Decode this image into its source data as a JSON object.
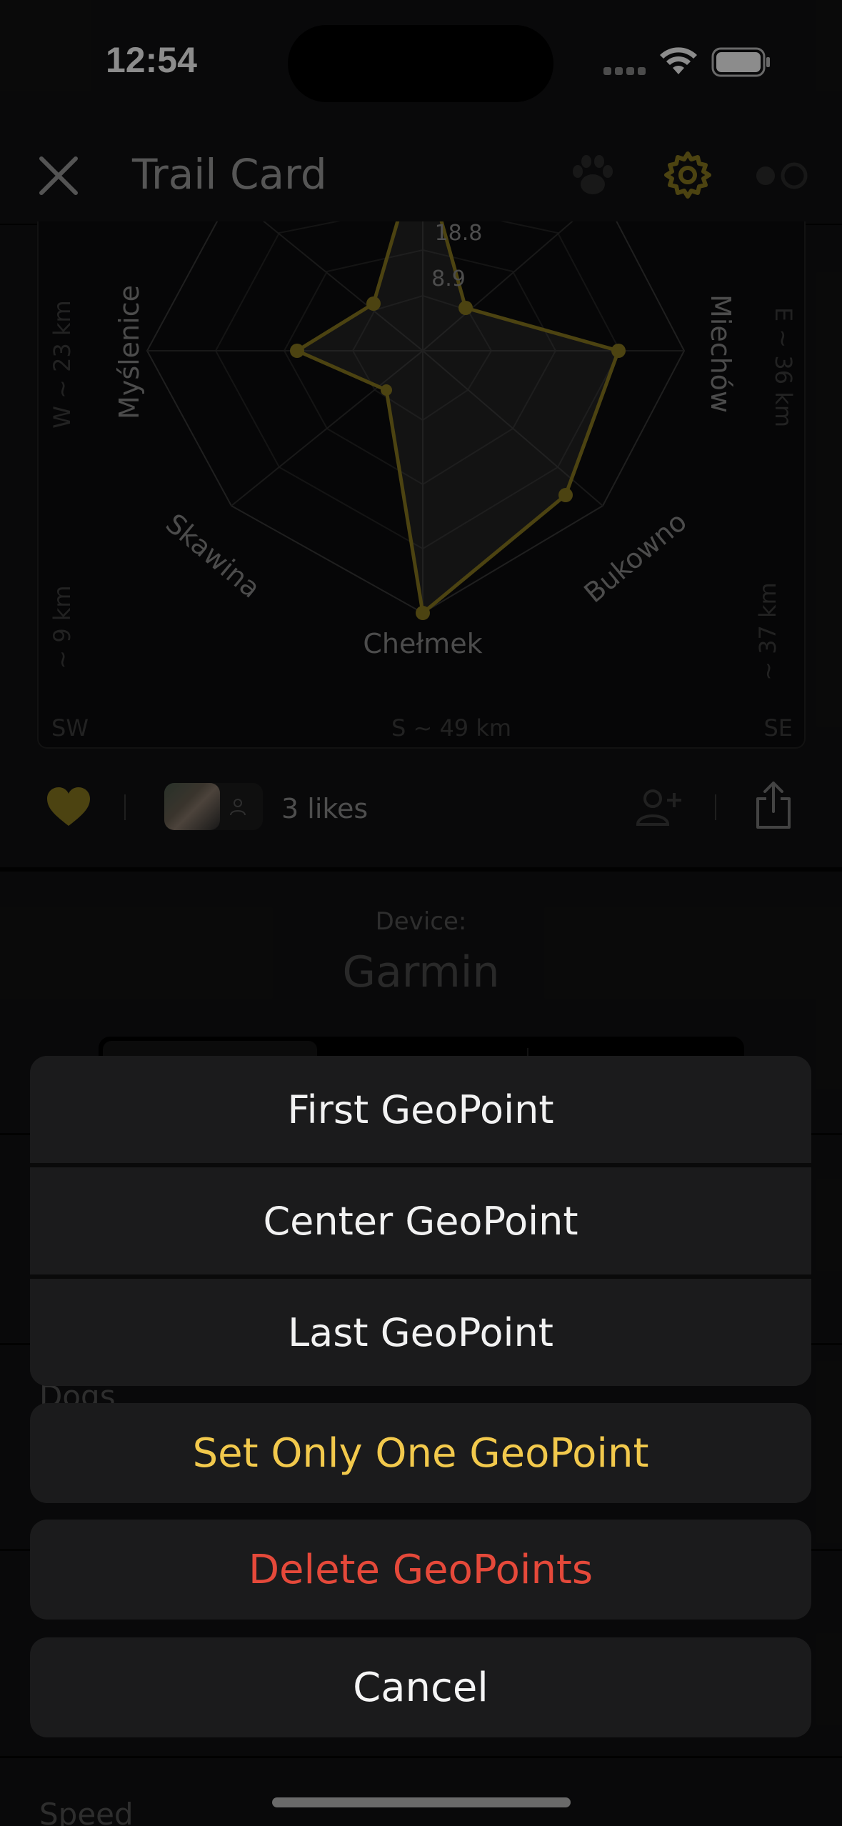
{
  "status_bar": {
    "time": "12:54"
  },
  "nav": {
    "title": "Trail Card"
  },
  "radar": {
    "ring_labels": [
      "18.8",
      "8.9"
    ],
    "axis_labels": [
      "Myślenice",
      "Miechów",
      "Skawina",
      "Bukowno",
      "Chełmek"
    ],
    "edge_labels": {
      "w": "W ~ 23 km",
      "e": "E ~ 36 km",
      "sw_dist": "~ 9 km",
      "se_dist": "~ 37 km",
      "sw": "SW",
      "se": "SE",
      "s": "S ~ 49 km"
    }
  },
  "likes": {
    "count_text": "3 likes"
  },
  "device": {
    "label": "Device:",
    "name": "Garmin"
  },
  "background": {
    "dogs_label": "Dogs",
    "speed_label": "Speed"
  },
  "action_sheet": {
    "items": [
      "First GeoPoint",
      "Center GeoPoint",
      "Last GeoPoint"
    ],
    "set_one": "Set Only One GeoPoint",
    "delete": "Delete GeoPoints",
    "cancel": "Cancel"
  },
  "colors": {
    "accent_gold": "#8b7a1f",
    "set_one_text": "#f2c94c",
    "delete_text": "#e5493a"
  }
}
